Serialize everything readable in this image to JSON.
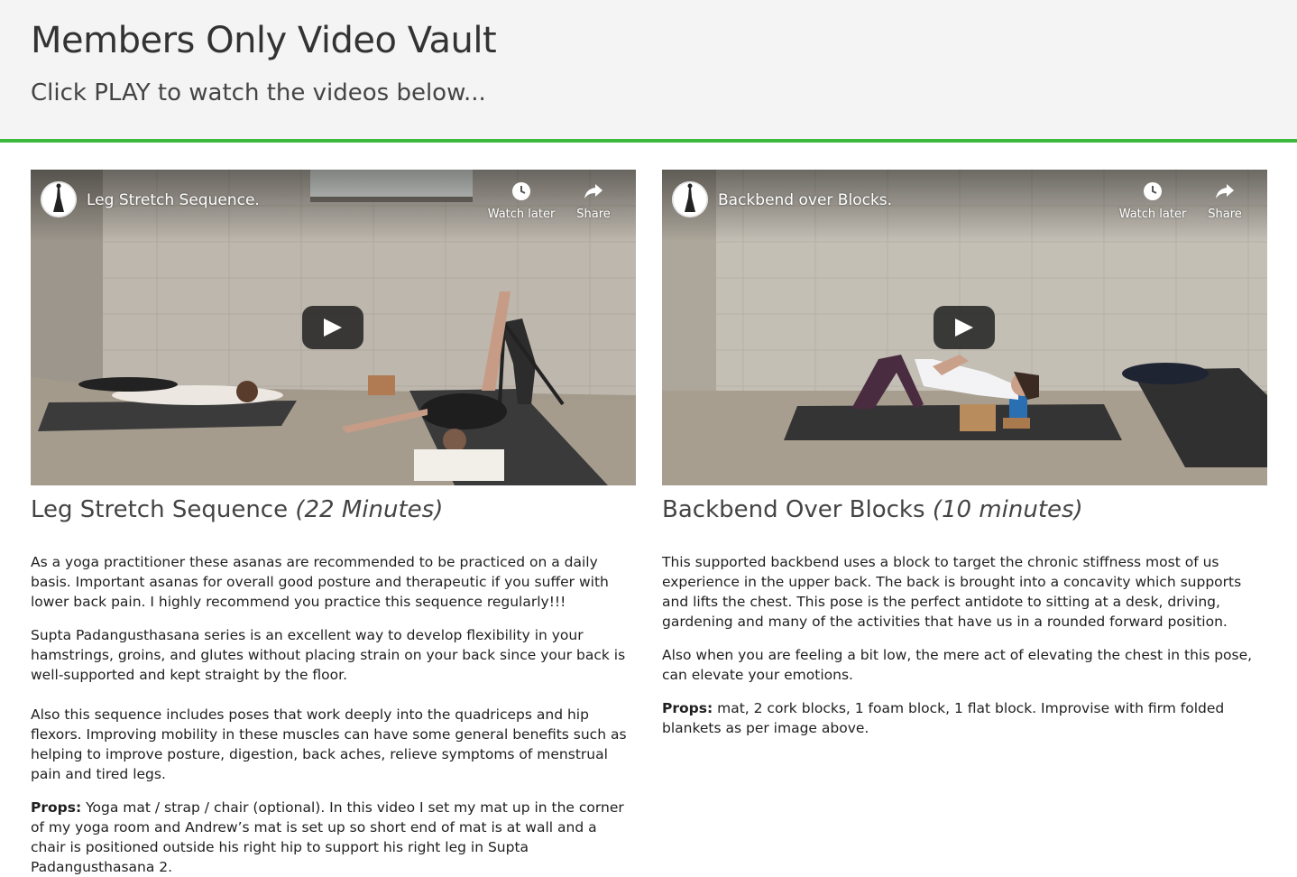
{
  "header": {
    "title": "Members Only Video Vault",
    "subtitle": "Click PLAY to watch the videos below..."
  },
  "accent_color": "#3db93d",
  "videos": [
    {
      "player_title": "Leg Stretch Sequence.",
      "watch_later_label": "Watch later",
      "share_label": "Share",
      "heading": "Leg Stretch Sequence",
      "duration": "(22 Minutes)",
      "paragraphs": [
        "As a yoga practitioner these asanas are recommended to be practiced on a daily basis. Important asanas for overall good posture and therapeutic if you suffer with lower back pain.  I highly recommend you practice this sequence regularly!!!",
        "Supta Padangusthasana series is an excellent way to develop flexibility in your hamstrings, groins, and glutes without placing strain on your back since your back is well-supported and kept straight by the floor.",
        "Also this sequence includes poses that work deeply into the quadriceps and hip flexors. Improving mobility in these muscles can have some general benefits such as helping to improve posture, digestion, back aches, relieve symptoms of menstrual pain and tired legs."
      ],
      "props_label": "Props:",
      "props_text": " Yoga mat / strap / chair (optional).  In this video I set my mat up in the corner of my yoga room and Andrew’s mat is set up so short end of mat is at wall and a chair is positioned outside his right hip to support his right leg in Supta Padangusthasana 2."
    },
    {
      "player_title": "Backbend over Blocks.",
      "watch_later_label": "Watch later",
      "share_label": "Share",
      "heading": "Backbend Over Blocks",
      "duration": "(10 minutes)",
      "paragraphs": [
        "This supported backbend uses a block to target the chronic stiffness most of us experience in the upper back. The back is brought into a concavity which supports and lifts the chest.  This pose is the perfect antidote to sitting at a desk, driving, gardening and many of the activities that have us in a rounded forward position.",
        "Also when you are feeling a bit low, the mere act of elevating the chest in this pose, can elevate your emotions."
      ],
      "props_label": "Props:",
      "props_text": " mat, 2 cork blocks, 1 foam block, 1 flat block.  Improvise with firm folded blankets as per image above."
    }
  ]
}
